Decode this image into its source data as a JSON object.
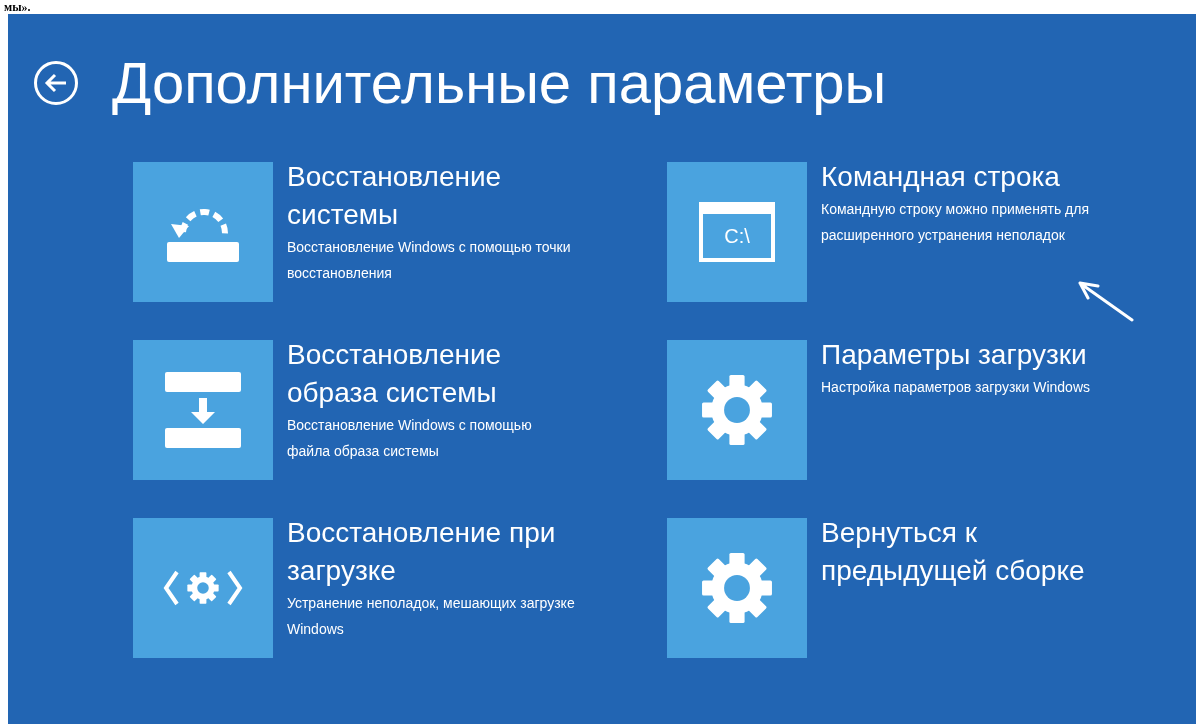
{
  "page_text": "мы».",
  "screen": {
    "title": "Дополнительные параметры",
    "options": [
      {
        "kind": "restore",
        "title": "Восстановление системы",
        "description": "Восстановление Windows с помощью точки восстановления"
      },
      {
        "kind": "cmd",
        "icon_text": "C:\\",
        "title": "Командная строка",
        "description": "Командную строку можно применять для расширенного устранения неполадок"
      },
      {
        "kind": "image",
        "title": "Восстановление образа системы",
        "description": "Восстановление Windows с помощью файла образа системы"
      },
      {
        "kind": "gear",
        "title": "Параметры загрузки",
        "description": "Настройка параметров загрузки Windows"
      },
      {
        "kind": "startup",
        "title": "Восстановление при загрузке",
        "description": "Устранение неполадок, мешающих загрузке Windows"
      },
      {
        "kind": "gear",
        "title": "Вернуться к предыдущей сборке"
      }
    ]
  }
}
